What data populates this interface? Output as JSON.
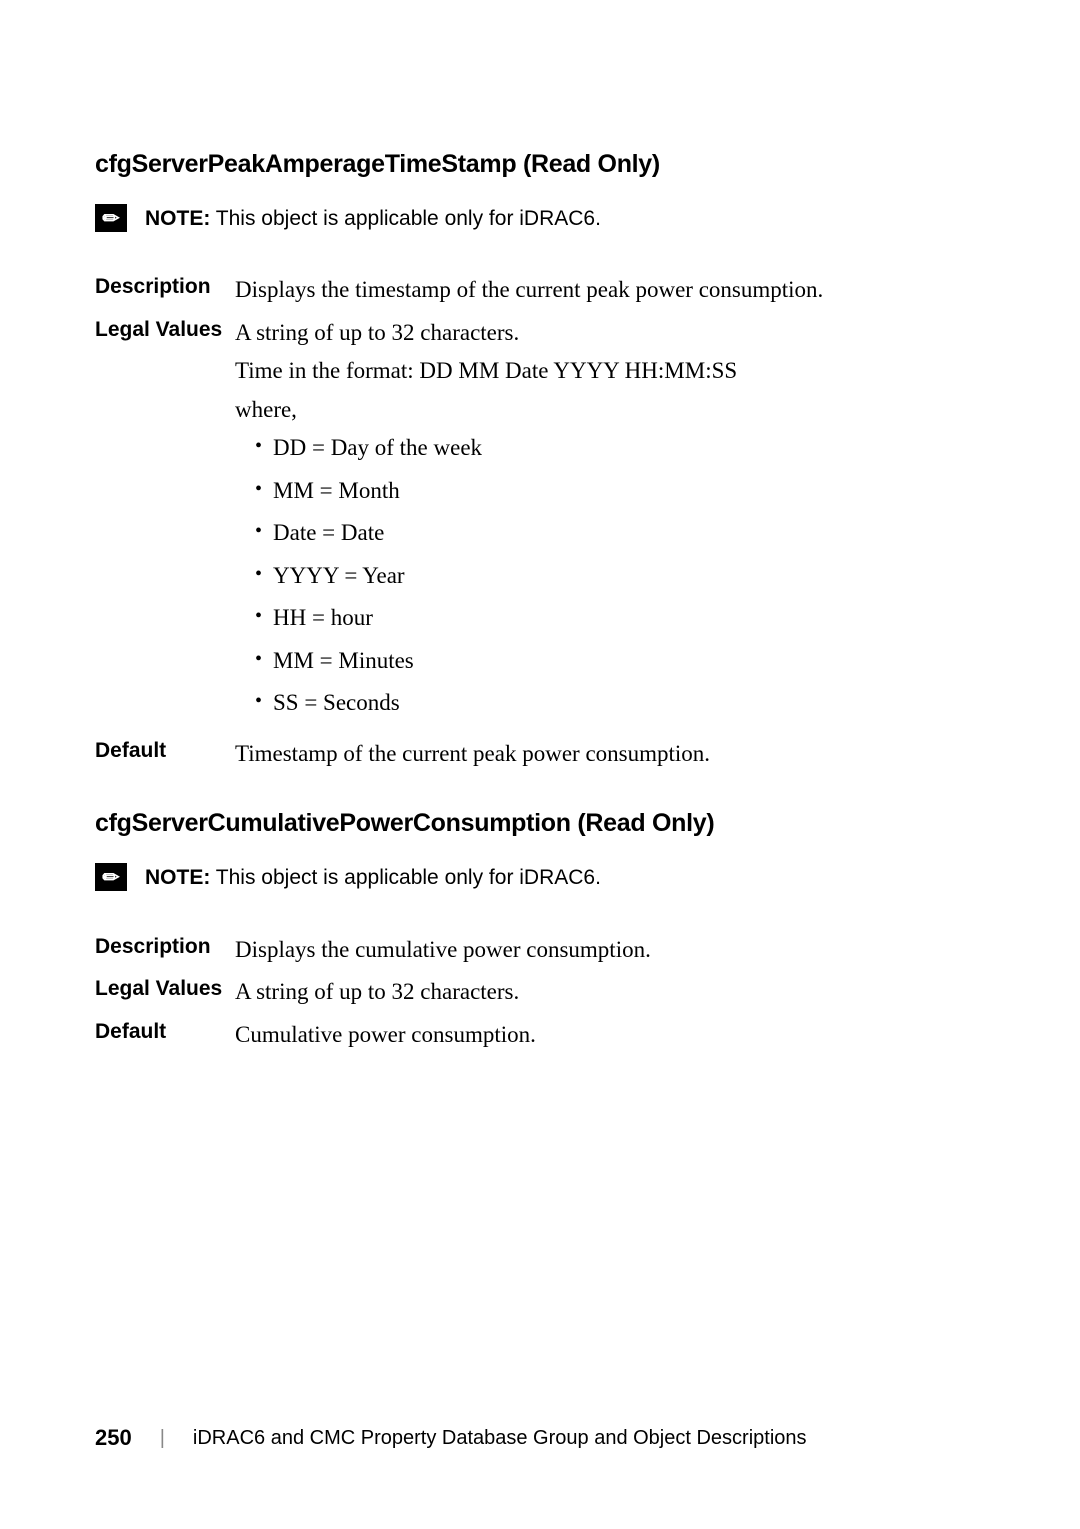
{
  "section1": {
    "heading": "cfgServerPeakAmperageTimeStamp (Read Only)",
    "note_label": "NOTE:",
    "note_text": " This object is applicable only for iDRAC6.",
    "rows": {
      "description": {
        "label": "Description",
        "value": "Displays the timestamp of the current peak power consumption."
      },
      "legal_values": {
        "label": "Legal Values",
        "line1": "A string of up to 32 characters.",
        "line2": "Time in the format: DD MM Date YYYY HH:MM:SS",
        "line3": "where,",
        "bullets": [
          "DD = Day of the week",
          "MM = Month",
          "Date = Date",
          "YYYY = Year",
          "HH = hour",
          "MM = Minutes",
          "SS = Seconds"
        ]
      },
      "default": {
        "label": "Default",
        "value": "Timestamp of the current peak power consumption."
      }
    }
  },
  "section2": {
    "heading": "cfgServerCumulativePowerConsumption (Read Only)",
    "note_label": "NOTE:",
    "note_text": " This object is applicable only for iDRAC6.",
    "rows": {
      "description": {
        "label": "Description",
        "value": "Displays the cumulative power consumption."
      },
      "legal_values": {
        "label": "Legal Values",
        "value": "A string of up to 32 characters."
      },
      "default": {
        "label": "Default",
        "value": "Cumulative power consumption."
      }
    }
  },
  "footer": {
    "page_number": "250",
    "divider": "|",
    "title": "iDRAC6 and CMC Property Database Group and Object Descriptions"
  }
}
